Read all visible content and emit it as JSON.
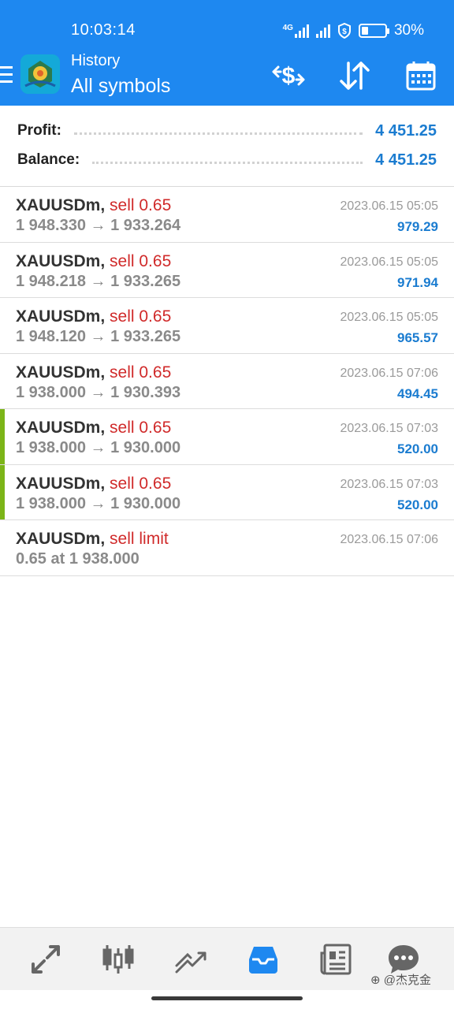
{
  "status_bar": {
    "time": "10:03:14",
    "network": "4G",
    "battery": "30%",
    "battery_level": 0.3
  },
  "header": {
    "subtitle": "History",
    "title": "All symbols",
    "icons": [
      "menu-icon",
      "app-logo",
      "deposit-icon",
      "sort-icon",
      "calendar-icon"
    ]
  },
  "summary": {
    "profit_label": "Profit:",
    "profit_value": "4 451.25",
    "balance_label": "Balance:",
    "balance_value": "4 451.25"
  },
  "trades": [
    {
      "symbol": "XAUUSDm,",
      "side": "sell 0.65",
      "prices": "1 948.330 → 1 933.264",
      "date": "2023.06.15 05:05",
      "pnl": "979.29",
      "marked": false
    },
    {
      "symbol": "XAUUSDm,",
      "side": "sell 0.65",
      "prices": "1 948.218 → 1 933.265",
      "date": "2023.06.15 05:05",
      "pnl": "971.94",
      "marked": false
    },
    {
      "symbol": "XAUUSDm,",
      "side": "sell 0.65",
      "prices": "1 948.120 → 1 933.265",
      "date": "2023.06.15 05:05",
      "pnl": "965.57",
      "marked": false
    },
    {
      "symbol": "XAUUSDm,",
      "side": "sell 0.65",
      "prices": "1 938.000 → 1 930.393",
      "date": "2023.06.15 07:06",
      "pnl": "494.45",
      "marked": false
    },
    {
      "symbol": "XAUUSDm,",
      "side": "sell 0.65",
      "prices": "1 938.000 → 1 930.000",
      "date": "2023.06.15 07:03",
      "pnl": "520.00",
      "marked": true
    },
    {
      "symbol": "XAUUSDm,",
      "side": "sell 0.65",
      "prices": "1 938.000 → 1 930.000",
      "date": "2023.06.15 07:03",
      "pnl": "520.00",
      "marked": true
    },
    {
      "symbol": "XAUUSDm,",
      "side": "sell limit",
      "prices": "0.65 at 1 938.000",
      "date": "2023.06.15 07:06",
      "pnl": "",
      "marked": false
    }
  ],
  "bottom_nav": {
    "items": [
      "quotes-icon",
      "chart-icon",
      "trade-icon",
      "history-icon",
      "news-icon",
      "chat-icon"
    ],
    "active": "history-icon"
  },
  "watermark": "@杰克金",
  "colors": {
    "header": "#1e88f0",
    "profit": "#1b7cd0",
    "sell": "#d02a2a",
    "active_tab": "#1e88f0",
    "marker": "#7cb518"
  }
}
